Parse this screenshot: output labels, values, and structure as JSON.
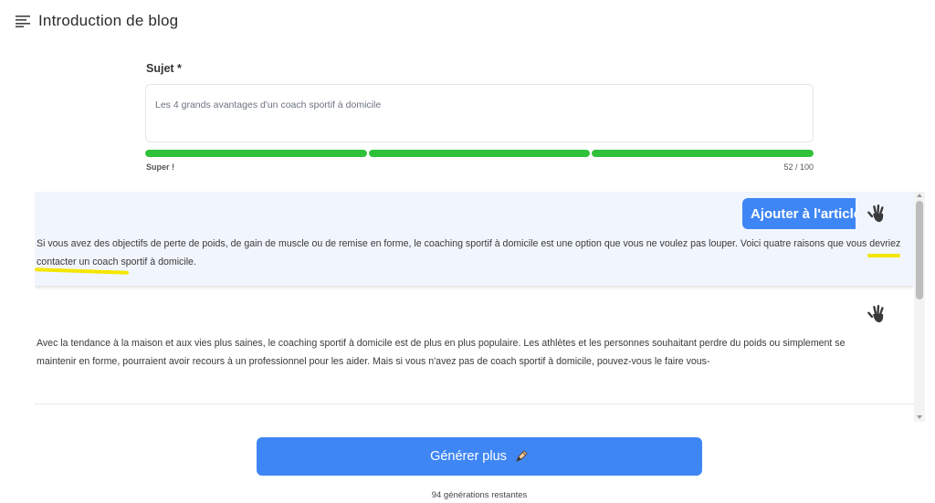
{
  "header": {
    "title": "Introduction de blog",
    "menu_icon": "hamburger-icon"
  },
  "form": {
    "subject_label": "Sujet *",
    "subject_value": "Les 4 grands avantages d'un coach sportif à domicile",
    "quality_label": "Super !",
    "char_count": "52 / 100",
    "progress_segments": [
      1,
      1,
      1
    ],
    "progress_color": "#2fc13a"
  },
  "results": [
    {
      "add_label": "Ajouter à l'article",
      "text": "Si vous avez des objectifs de perte de poids, de gain de muscle ou de remise en forme, le coaching sportif à domicile est une option que vous ne voulez pas louper. Voici quatre raisons que vous devriez contacter un coach sportif à domicile.",
      "icon": "hand-wave-icon"
    },
    {
      "text": "Avec la tendance à la maison et aux vies plus saines, le coaching sportif à domicile est de plus en plus populaire. Les athlètes et les personnes souhaitant perdre du poids ou simplement se maintenir en forme, pourraient avoir recours à un professionnel pour les aider. Mais si vous n'avez pas de coach sportif à domicile, pouvez-vous le faire vous-",
      "icon": "hand-wave-icon"
    }
  ],
  "generate": {
    "label": "Générer plus",
    "icon": "pen-icon",
    "remaining": "94 générations restantes"
  },
  "colors": {
    "primary": "#3f86f5",
    "highlight": "#f4e600",
    "card_bg": "#f1f5fd"
  }
}
